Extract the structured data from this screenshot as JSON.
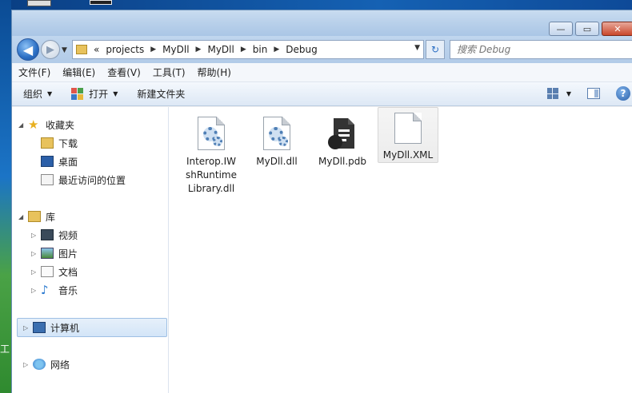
{
  "window": {
    "controls": {
      "minimize": "—",
      "maximize": "▭",
      "close": "✕"
    }
  },
  "desktop": {
    "edge_text": "工"
  },
  "nav": {
    "back_glyph": "◀",
    "forward_glyph": "▶",
    "recent_glyph": "▼",
    "breadcrumb_lead": "«",
    "breadcrumbs": [
      "projects",
      "MyDll",
      "MyDll",
      "bin",
      "Debug"
    ],
    "separator": "▶",
    "dropdown_glyph": "▼",
    "refresh_glyph": "↻"
  },
  "search": {
    "placeholder": "搜索 Debug"
  },
  "menu": {
    "items": [
      "文件(F)",
      "编辑(E)",
      "查看(V)",
      "工具(T)",
      "帮助(H)"
    ]
  },
  "toolbar": {
    "organize": "组织",
    "open": "打开",
    "new_folder": "新建文件夹",
    "caret": "▼",
    "help": "?"
  },
  "sidebar": {
    "expanded_arrow": "◢",
    "collapsed_arrow": "▷",
    "favorites": {
      "label": "收藏夹",
      "items": [
        "下载",
        "桌面",
        "最近访问的位置"
      ]
    },
    "libraries": {
      "label": "库",
      "items": [
        "视频",
        "图片",
        "文档",
        "音乐"
      ]
    },
    "computer": {
      "label": "计算机"
    },
    "network": {
      "label": "网络"
    }
  },
  "files": [
    {
      "name": "Interop.IWshRuntimeLibrary.dll",
      "lines": [
        "Interop.IW",
        "shRuntime",
        "Library.dll"
      ],
      "icon": "dll-gear-icon"
    },
    {
      "name": "MyDll.dll",
      "lines": [
        "MyDll.dll"
      ],
      "icon": "dll-gear-icon"
    },
    {
      "name": "MyDll.pdb",
      "lines": [
        "MyDll.pdb"
      ],
      "icon": "pdb-file-icon"
    },
    {
      "name": "MyDll.XML",
      "lines": [
        "MyDll.XML"
      ],
      "icon": "blank-file-icon",
      "selected": true
    }
  ],
  "colors": {
    "selection_bg": "#d3e5f8",
    "selection_border": "#9fc0e4",
    "titlebar": "#b8d0ea",
    "close_button": "#c9482c"
  }
}
